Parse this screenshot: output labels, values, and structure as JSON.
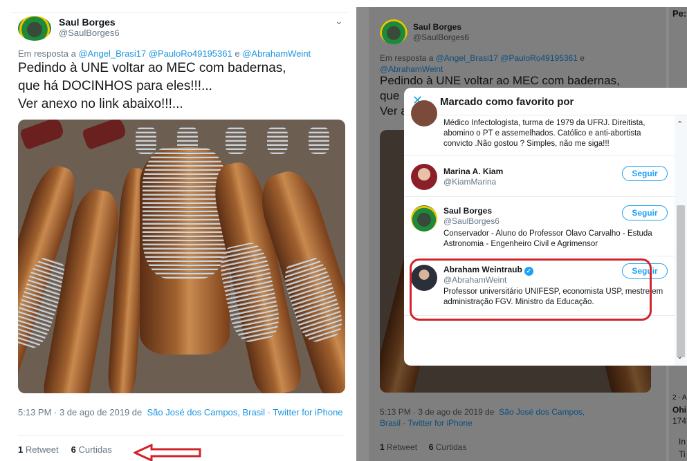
{
  "left": {
    "author_name": "Saul Borges",
    "author_handle": "@SaulBorges6",
    "chevron": "⌄",
    "reply_prefix": "Em resposta a",
    "reply_mentions": "@Angel_Brasi17 @PauloRo49195361",
    "reply_and": "e",
    "reply_last": "@AbrahamWeint",
    "tweet_line1": "Pedindo à UNE voltar ao MEC com badernas,",
    "tweet_line2": "que há DOCINHOS para eles!!!...",
    "tweet_line3": "Ver anexo no link abaixo!!!...",
    "meta_time": "5:13 PM · 3 de ago de 2019 de",
    "meta_place": "São José dos Campos, Brasil",
    "meta_sep": "·",
    "meta_source": "Twitter for iPhone",
    "retweet_count": "1",
    "retweet_label": "Retweet",
    "likes_count": "6",
    "likes_label": "Curtidas"
  },
  "right": {
    "author_name": "Saul Borges",
    "author_handle": "@SaulBorges6",
    "chevron": "⌄",
    "reply_prefix": "Em resposta a",
    "reply_mentions": "@Angel_Brasi17 @PauloRo49195361",
    "reply_and": "e",
    "reply_last": "@AbrahamWeint",
    "tweet_line1": "Pedindo à UNE voltar ao MEC com badernas,",
    "tweet_line2": "que",
    "tweet_line3": "Ver a",
    "meta_time": "5:13 PM · 3 de ago de 2019 de",
    "meta_place": "São José dos Campos,",
    "meta_place2": "Brasil",
    "meta_sep": "·",
    "meta_source": "Twitter for iPhone",
    "retweet_count": "1",
    "retweet_label": "Retweet",
    "likes_count": "6",
    "likes_label": "Curtidas",
    "side_top": "Pe:",
    "side_bottom_1": "2 · A",
    "side_bottom_2": "Ohi",
    "side_bottom_3": "174",
    "side_bottom_4": "In",
    "side_bottom_5": "Ti"
  },
  "modal": {
    "close": "✕",
    "title": "Marcado como favorito por",
    "scroll_up": "⌃",
    "scroll_down": "⌄",
    "users": [
      {
        "name": "",
        "handle": "",
        "bio": "Médico Infectologista, turma de 1979 da UFRJ. Direitista, abomino o PT e assemelhados. Católico e anti-abortista convicto .Não gostou ? Simples, não me siga!!!"
      },
      {
        "name": "Marina A. Kiam",
        "handle": "@KiamMarina",
        "button": "Seguir"
      },
      {
        "name": "Saul Borges",
        "handle": "@SaulBorges6",
        "button": "Seguir",
        "bio": "Conservador - Aluno do Professor Olavo Carvalho - Estuda Astronomia - Engenheiro Civil e Agrimensor"
      },
      {
        "name": "Abraham Weintraub",
        "verified": "✓",
        "handle": "@AbrahamWeint",
        "button": "Seguir",
        "bio": "Professor universitário UNIFESP, economista USP, mestre em administração FGV. Ministro da Educação."
      }
    ]
  },
  "colors": {
    "link": "#1b95e0",
    "follow": "#1da1f2",
    "highlight": "#d2232a",
    "arrow": "#d2232a"
  }
}
